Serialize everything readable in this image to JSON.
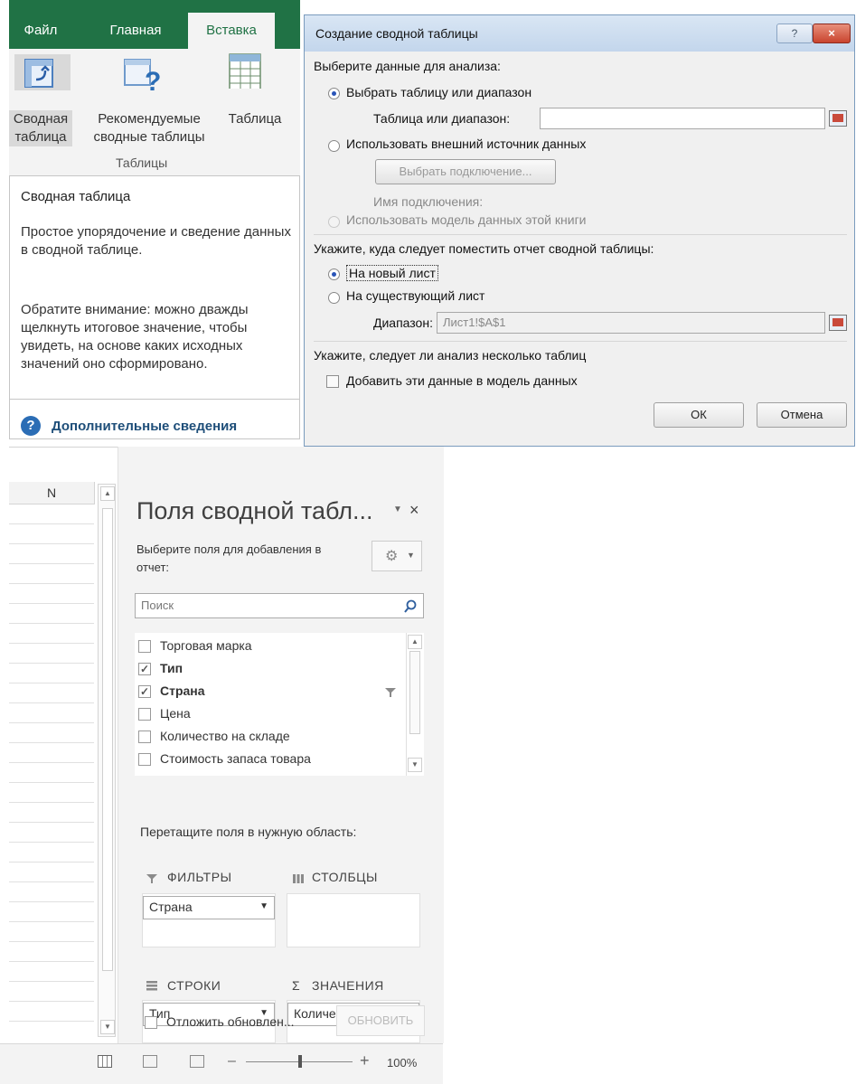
{
  "ribbon": {
    "tabs": [
      {
        "label": "Файл"
      },
      {
        "label": "Главная"
      },
      {
        "label": "Вставка"
      }
    ],
    "buttons": [
      {
        "label1": "Сводная",
        "label2": "таблица",
        "icon": "pivot-table-icon"
      },
      {
        "label1": "Рекомендуемые",
        "label2": "сводные таблицы",
        "icon": "recommended-pivot-icon"
      },
      {
        "label1": "Таблица",
        "label2": "",
        "icon": "table-icon"
      }
    ],
    "group_label": "Таблицы"
  },
  "tooltip": {
    "title": "Сводная таблица",
    "text1": "Простое упорядочение и сведение данных в сводной таблице.",
    "text2": "Обратите внимание: можно дважды щелкнуть итоговое значение, чтобы увидеть, на основе каких исходных значений оно сформировано.",
    "link": "Дополнительные сведения"
  },
  "dialog": {
    "title": "Создание сводной таблицы",
    "help": "?",
    "close": "×",
    "section1": "Выберите данные для анализа:",
    "opt_range": "Выбрать таблицу или диапазон",
    "range_label": "Таблица или диапазон:",
    "range_value": "",
    "opt_external": "Использовать внешний источник данных",
    "choose_conn": "Выбрать подключение...",
    "conn_name_label": "Имя подключения:",
    "opt_model": "Использовать модель данных этой книги",
    "section2": "Укажите, куда следует поместить отчет сводной таблицы:",
    "opt_new_sheet": "На новый лист",
    "opt_existing": "На существующий лист",
    "location_label": "Диапазон:",
    "location_value": "Лист1!$A$1",
    "section3": "Укажите, следует ли анализ несколько таблиц",
    "add_model": "Добавить эти данные в модель данных",
    "ok": "ОК",
    "cancel": "Отмена"
  },
  "sheet": {
    "column": "N",
    "zoom": "100%"
  },
  "pane": {
    "title": "Поля сводной табл...",
    "close": "×",
    "hint": "Выберите поля для добавления в отчет:",
    "search_placeholder": "Поиск",
    "fields": [
      {
        "label": "Торговая марка",
        "checked": false,
        "bold": false
      },
      {
        "label": "Тип",
        "checked": true,
        "bold": true
      },
      {
        "label": "Страна",
        "checked": true,
        "bold": true
      },
      {
        "label": "Цена",
        "checked": false,
        "bold": false
      },
      {
        "label": "Количество на складе",
        "checked": false,
        "bold": false
      },
      {
        "label": "Стоимость запаса товара",
        "checked": false,
        "bold": false
      }
    ],
    "areas_hint": "Перетащите поля в нужную область:",
    "filters": {
      "title": "ФИЛЬТРЫ",
      "chip": "Страна"
    },
    "columns": {
      "title": "СТОЛБЦЫ"
    },
    "rows": {
      "title": "СТРОКИ",
      "chip": "Тип"
    },
    "values": {
      "title": "ЗНАЧЕНИЯ",
      "chip": "Количество п..."
    },
    "defer_label": "Отложить обновлен...",
    "update": "ОБНОВИТЬ"
  }
}
